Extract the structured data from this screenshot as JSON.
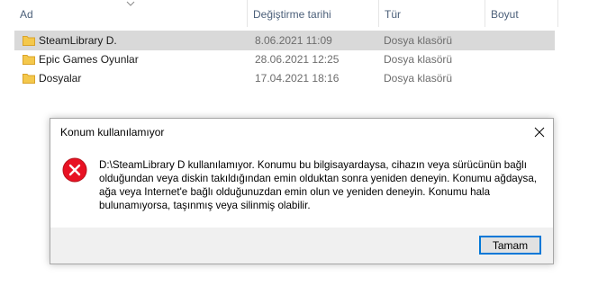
{
  "columns": {
    "name": "Ad",
    "date": "Değiştirme tarihi",
    "type": "Tür",
    "size": "Boyut"
  },
  "files": [
    {
      "name": "SteamLibrary D.",
      "date": "8.06.2021 11:09",
      "type": "Dosya klasörü",
      "selected": true,
      "icon": "folder-icon"
    },
    {
      "name": "Epic Games Oyunlar",
      "date": "28.06.2021 12:25",
      "type": "Dosya klasörü",
      "selected": false,
      "icon": "folder-icon"
    },
    {
      "name": "Dosyalar",
      "date": "17.04.2021 18:16",
      "type": "Dosya klasörü",
      "selected": false,
      "icon": "folder-icon"
    }
  ],
  "dialog": {
    "title": "Konum kullanılamıyor",
    "message": "D:\\SteamLibrary D kullanılamıyor. Konumu bu bilgisayardaysa, cihazın veya sürücünün bağlı olduğundan veya diskin takıldığından emin olduktan sonra yeniden deneyin. Konumu ağdaysa, ağa veya Internet'e bağlı olduğunuzdan emin olun ve yeniden deneyin. Konumu hala bulunamıyorsa, taşınmış veya silinmiş olabilir.",
    "ok_label": "Tamam",
    "icon": "error-icon"
  },
  "colors": {
    "header_text": "#4c607a",
    "selection": "#d9d9d9",
    "folder": "#f4c84c",
    "error": "#e81123",
    "button_border": "#0078d7"
  }
}
